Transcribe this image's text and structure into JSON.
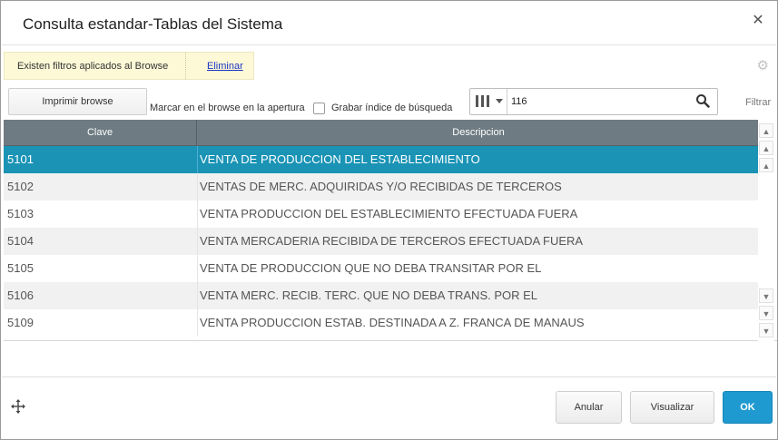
{
  "window": {
    "title": "Consulta estandar-Tablas del Sistema"
  },
  "filters": {
    "message": "Existen filtros aplicados al Browse",
    "clear_link": "Eliminar"
  },
  "toolbar": {
    "print_button": "Imprimir browse",
    "mark_label": "Marcar en el browse en la apertura",
    "save_index_label": "Grabar índice de búsqueda",
    "save_index_checked": false,
    "search_value": "116",
    "filter_label": "Filtrar"
  },
  "grid": {
    "columns": [
      "Clave",
      "Descripcion"
    ],
    "selected_row": 0,
    "rows": [
      {
        "clave": "5101",
        "descripcion": "VENTA DE PRODUCCION DEL ESTABLECIMIENTO"
      },
      {
        "clave": "5102",
        "descripcion": "VENTAS DE MERC. ADQUIRIDAS Y/O RECIBIDAS DE TERCEROS"
      },
      {
        "clave": "5103",
        "descripcion": "VENTA PRODUCCION DEL ESTABLECIMIENTO EFECTUADA FUERA"
      },
      {
        "clave": "5104",
        "descripcion": "VENTA MERCADERIA RECIBIDA DE TERCEROS EFECTUADA FUERA"
      },
      {
        "clave": "5105",
        "descripcion": "VENTA DE PRODUCCION QUE NO DEBA TRANSITAR POR EL"
      },
      {
        "clave": "5106",
        "descripcion": "VENTA MERC. RECIB. TERC. QUE NO DEBA TRANS. POR EL"
      },
      {
        "clave": "5109",
        "descripcion": "VENTA PRODUCCION ESTAB. DESTINADA A Z. FRANCA DE MANAUS"
      }
    ]
  },
  "footer": {
    "cancel_button": "Anular",
    "view_button": "Visualizar",
    "ok_button": "OK"
  },
  "icons": {
    "close": "close-icon",
    "settings": "gear-icon",
    "columns": "columns-icon",
    "search": "search-icon",
    "move": "move-icon",
    "scroll": [
      "scroll-top-icon",
      "scroll-page-up-icon",
      "scroll-up-icon",
      "scroll-down-icon",
      "scroll-page-down-icon",
      "scroll-bottom-icon"
    ]
  },
  "colors": {
    "selection": "#1a93b5",
    "header": "#6e7b82",
    "filter_bg": "#fdf8d6",
    "primary_button": "#1f9ad1",
    "link": "#1b36c8"
  }
}
